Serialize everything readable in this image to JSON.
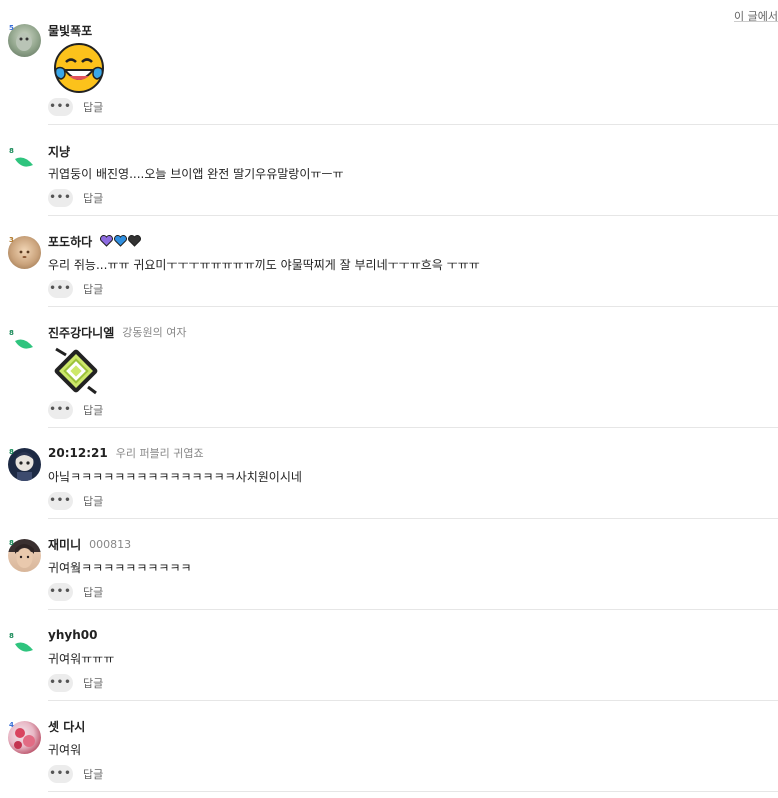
{
  "top_link": "이 글에서",
  "actions": {
    "more_label": "•••",
    "reply_label": "답글"
  },
  "comments": [
    {
      "nick": "물빛폭포",
      "level": "5",
      "tag": "",
      "text": "",
      "sticker": "laughing-tears-emoji"
    },
    {
      "nick": "지냥",
      "level": "8",
      "tag": "",
      "text": "귀엽둥이 배진영....오늘 브이앱 완전 딸기우유말랑이ㅠㅡㅠ",
      "sticker": ""
    },
    {
      "nick": "포도하다",
      "level": "3",
      "tag": "",
      "text": "우리 쥐능...ㅠㅠ 귀요미ㅜㅜㅜㅠㅠㅠㅠㅠ끼도 야물딱찌게 잘 부리네ㅜㅜㅠ흐윽 ㅜㅠㅠ",
      "sticker": "",
      "hearts": [
        "purple-heart",
        "blue-heart",
        "black-heart"
      ]
    },
    {
      "nick": "진주강다니엘",
      "level": "8",
      "tag": "강동원의 여자",
      "text": "",
      "sticker": "green-diamond-sticker"
    },
    {
      "nick": "20:12:21",
      "level": "8",
      "tag": "우리 퍼블리 귀엽죠",
      "text": "아닠ㅋㅋㅋㅋㅋㅋㅋㅋㅋㅋㅋㅋㅋㅋㅋ사치원이시네",
      "sticker": ""
    },
    {
      "nick": "재미니",
      "level": "8",
      "tag": "000813",
      "text": "귀여웤ㅋㅋㅋㅋㅋㅋㅋㅋㅋㅋ",
      "sticker": ""
    },
    {
      "nick": "yhyh00",
      "level": "8",
      "tag": "",
      "text": "귀여워ㅠㅠㅠ",
      "sticker": ""
    },
    {
      "nick": "셋 다시",
      "level": "4",
      "tag": "",
      "text": "귀여워",
      "sticker": ""
    }
  ],
  "colors": {
    "leaf": "#2fc47e",
    "divider": "#e6e6e6",
    "level_badge": "#1b8b5a"
  }
}
